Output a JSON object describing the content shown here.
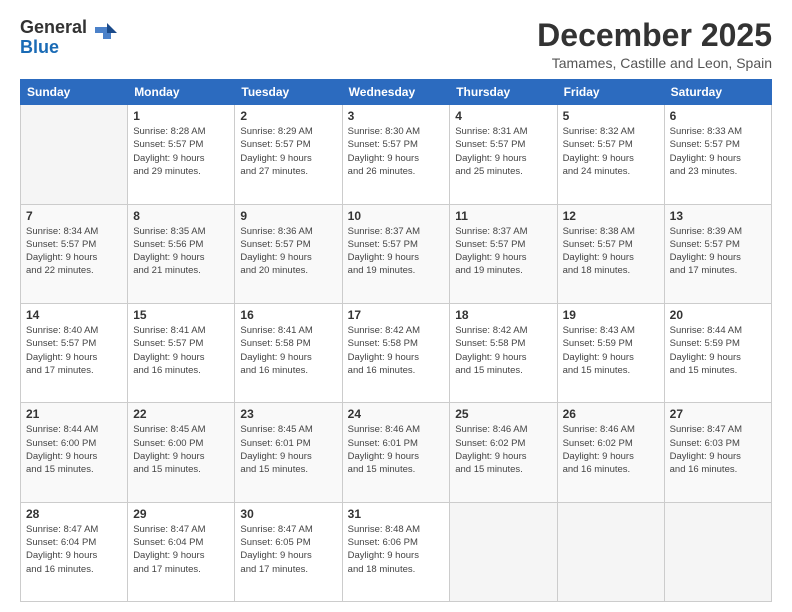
{
  "logo": {
    "general": "General",
    "blue": "Blue"
  },
  "header": {
    "month": "December 2025",
    "location": "Tamames, Castille and Leon, Spain"
  },
  "weekdays": [
    "Sunday",
    "Monday",
    "Tuesday",
    "Wednesday",
    "Thursday",
    "Friday",
    "Saturday"
  ],
  "weeks": [
    [
      {
        "day": "",
        "sunrise": "",
        "sunset": "",
        "daylight": ""
      },
      {
        "day": "1",
        "sunrise": "Sunrise: 8:28 AM",
        "sunset": "Sunset: 5:57 PM",
        "daylight": "Daylight: 9 hours and 29 minutes."
      },
      {
        "day": "2",
        "sunrise": "Sunrise: 8:29 AM",
        "sunset": "Sunset: 5:57 PM",
        "daylight": "Daylight: 9 hours and 27 minutes."
      },
      {
        "day": "3",
        "sunrise": "Sunrise: 8:30 AM",
        "sunset": "Sunset: 5:57 PM",
        "daylight": "Daylight: 9 hours and 26 minutes."
      },
      {
        "day": "4",
        "sunrise": "Sunrise: 8:31 AM",
        "sunset": "Sunset: 5:57 PM",
        "daylight": "Daylight: 9 hours and 25 minutes."
      },
      {
        "day": "5",
        "sunrise": "Sunrise: 8:32 AM",
        "sunset": "Sunset: 5:57 PM",
        "daylight": "Daylight: 9 hours and 24 minutes."
      },
      {
        "day": "6",
        "sunrise": "Sunrise: 8:33 AM",
        "sunset": "Sunset: 5:57 PM",
        "daylight": "Daylight: 9 hours and 23 minutes."
      }
    ],
    [
      {
        "day": "7",
        "sunrise": "Sunrise: 8:34 AM",
        "sunset": "Sunset: 5:57 PM",
        "daylight": "Daylight: 9 hours and 22 minutes."
      },
      {
        "day": "8",
        "sunrise": "Sunrise: 8:35 AM",
        "sunset": "Sunset: 5:56 PM",
        "daylight": "Daylight: 9 hours and 21 minutes."
      },
      {
        "day": "9",
        "sunrise": "Sunrise: 8:36 AM",
        "sunset": "Sunset: 5:57 PM",
        "daylight": "Daylight: 9 hours and 20 minutes."
      },
      {
        "day": "10",
        "sunrise": "Sunrise: 8:37 AM",
        "sunset": "Sunset: 5:57 PM",
        "daylight": "Daylight: 9 hours and 19 minutes."
      },
      {
        "day": "11",
        "sunrise": "Sunrise: 8:37 AM",
        "sunset": "Sunset: 5:57 PM",
        "daylight": "Daylight: 9 hours and 19 minutes."
      },
      {
        "day": "12",
        "sunrise": "Sunrise: 8:38 AM",
        "sunset": "Sunset: 5:57 PM",
        "daylight": "Daylight: 9 hours and 18 minutes."
      },
      {
        "day": "13",
        "sunrise": "Sunrise: 8:39 AM",
        "sunset": "Sunset: 5:57 PM",
        "daylight": "Daylight: 9 hours and 17 minutes."
      }
    ],
    [
      {
        "day": "14",
        "sunrise": "Sunrise: 8:40 AM",
        "sunset": "Sunset: 5:57 PM",
        "daylight": "Daylight: 9 hours and 17 minutes."
      },
      {
        "day": "15",
        "sunrise": "Sunrise: 8:41 AM",
        "sunset": "Sunset: 5:57 PM",
        "daylight": "Daylight: 9 hours and 16 minutes."
      },
      {
        "day": "16",
        "sunrise": "Sunrise: 8:41 AM",
        "sunset": "Sunset: 5:58 PM",
        "daylight": "Daylight: 9 hours and 16 minutes."
      },
      {
        "day": "17",
        "sunrise": "Sunrise: 8:42 AM",
        "sunset": "Sunset: 5:58 PM",
        "daylight": "Daylight: 9 hours and 16 minutes."
      },
      {
        "day": "18",
        "sunrise": "Sunrise: 8:42 AM",
        "sunset": "Sunset: 5:58 PM",
        "daylight": "Daylight: 9 hours and 15 minutes."
      },
      {
        "day": "19",
        "sunrise": "Sunrise: 8:43 AM",
        "sunset": "Sunset: 5:59 PM",
        "daylight": "Daylight: 9 hours and 15 minutes."
      },
      {
        "day": "20",
        "sunrise": "Sunrise: 8:44 AM",
        "sunset": "Sunset: 5:59 PM",
        "daylight": "Daylight: 9 hours and 15 minutes."
      }
    ],
    [
      {
        "day": "21",
        "sunrise": "Sunrise: 8:44 AM",
        "sunset": "Sunset: 6:00 PM",
        "daylight": "Daylight: 9 hours and 15 minutes."
      },
      {
        "day": "22",
        "sunrise": "Sunrise: 8:45 AM",
        "sunset": "Sunset: 6:00 PM",
        "daylight": "Daylight: 9 hours and 15 minutes."
      },
      {
        "day": "23",
        "sunrise": "Sunrise: 8:45 AM",
        "sunset": "Sunset: 6:01 PM",
        "daylight": "Daylight: 9 hours and 15 minutes."
      },
      {
        "day": "24",
        "sunrise": "Sunrise: 8:46 AM",
        "sunset": "Sunset: 6:01 PM",
        "daylight": "Daylight: 9 hours and 15 minutes."
      },
      {
        "day": "25",
        "sunrise": "Sunrise: 8:46 AM",
        "sunset": "Sunset: 6:02 PM",
        "daylight": "Daylight: 9 hours and 15 minutes."
      },
      {
        "day": "26",
        "sunrise": "Sunrise: 8:46 AM",
        "sunset": "Sunset: 6:02 PM",
        "daylight": "Daylight: 9 hours and 16 minutes."
      },
      {
        "day": "27",
        "sunrise": "Sunrise: 8:47 AM",
        "sunset": "Sunset: 6:03 PM",
        "daylight": "Daylight: 9 hours and 16 minutes."
      }
    ],
    [
      {
        "day": "28",
        "sunrise": "Sunrise: 8:47 AM",
        "sunset": "Sunset: 6:04 PM",
        "daylight": "Daylight: 9 hours and 16 minutes."
      },
      {
        "day": "29",
        "sunrise": "Sunrise: 8:47 AM",
        "sunset": "Sunset: 6:04 PM",
        "daylight": "Daylight: 9 hours and 17 minutes."
      },
      {
        "day": "30",
        "sunrise": "Sunrise: 8:47 AM",
        "sunset": "Sunset: 6:05 PM",
        "daylight": "Daylight: 9 hours and 17 minutes."
      },
      {
        "day": "31",
        "sunrise": "Sunrise: 8:48 AM",
        "sunset": "Sunset: 6:06 PM",
        "daylight": "Daylight: 9 hours and 18 minutes."
      },
      {
        "day": "",
        "sunrise": "",
        "sunset": "",
        "daylight": ""
      },
      {
        "day": "",
        "sunrise": "",
        "sunset": "",
        "daylight": ""
      },
      {
        "day": "",
        "sunrise": "",
        "sunset": "",
        "daylight": ""
      }
    ]
  ]
}
